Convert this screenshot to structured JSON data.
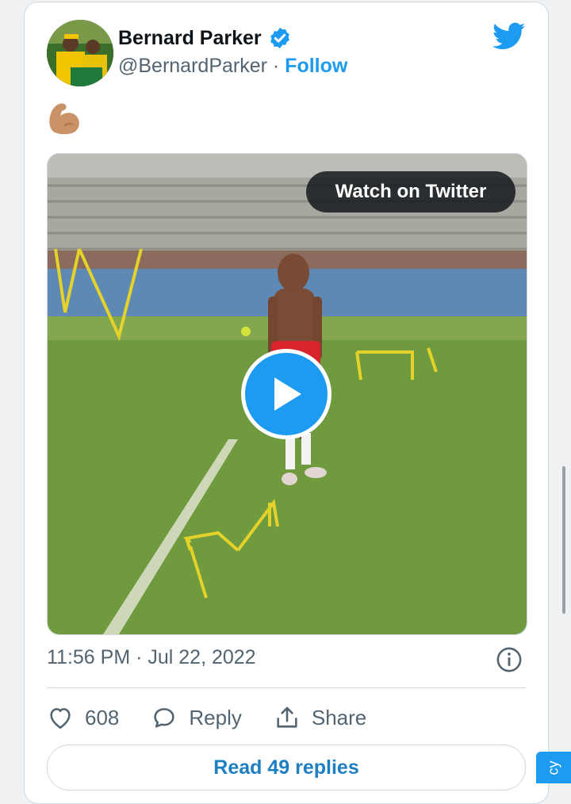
{
  "tweet": {
    "author_name": "Bernard Parker",
    "handle": "@BernardParker",
    "separator": " · ",
    "follow_label": "Follow",
    "body_emoji": "flexed-biceps-emoji",
    "video": {
      "watch_label": "Watch on Twitter",
      "play_icon": "play-icon"
    },
    "timestamp": "11:56 PM · Jul 22, 2022",
    "actions": {
      "like_count": "608",
      "reply_label": "Reply",
      "share_label": "Share"
    },
    "read_replies_label": "Read 49 replies"
  },
  "side_tab": {
    "label": "cy"
  },
  "colors": {
    "accent": "#1d9bf0",
    "text_muted": "#536471",
    "border": "#cfd9de"
  }
}
